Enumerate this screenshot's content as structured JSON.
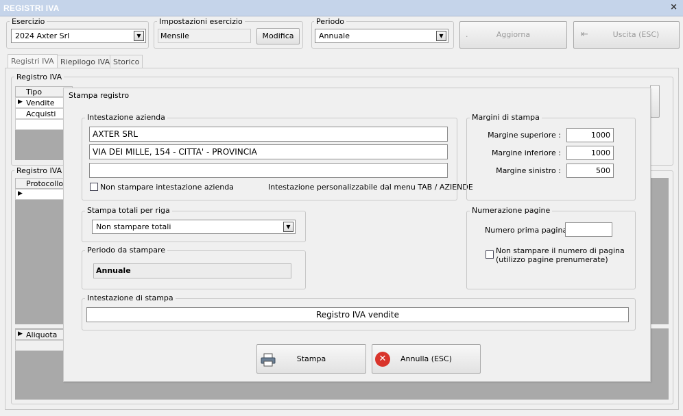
{
  "window": {
    "title": "REGISTRI IVA",
    "close": "×"
  },
  "esercizio": {
    "label": "Esercizio",
    "value": "2024 Axter Srl"
  },
  "impostazioni": {
    "label": "Impostazioni esercizio",
    "value": "Mensile",
    "button": "Modifica"
  },
  "periodo_top": {
    "label": "Periodo",
    "value": "Annuale"
  },
  "toolbar": {
    "aggiorna": "Aggiorna",
    "uscita": "Uscita (ESC)"
  },
  "tabs": [
    "Registri IVA",
    "Riepilogo IVA",
    "Storico"
  ],
  "registro_group": {
    "label": "Registro IVA",
    "col_tipo": "Tipo",
    "rows": [
      "Vendite",
      "Acquisti"
    ]
  },
  "registro_v": {
    "label": "Registro IVA v",
    "col": "Protocollo"
  },
  "aliquota": {
    "col": "Aliquota"
  },
  "dialog": {
    "title": "Stampa registro",
    "intestazione": {
      "label": "Intestazione azienda",
      "line1": "AXTER SRL",
      "line2": "VIA DEI MILLE, 154 - CITTA' - PROVINCIA",
      "line3": "",
      "no_stampa": "Non stampare intestazione azienda",
      "note": "Intestazione personalizzabile dal menu TAB / AZIENDE"
    },
    "margini": {
      "label": "Margini di stampa",
      "superiore_label": "Margine superiore :",
      "superiore": "1000",
      "inferiore_label": "Margine inferiore :",
      "inferiore": "1000",
      "sinistro_label": "Margine sinistro :",
      "sinistro": "500"
    },
    "totali": {
      "label": "Stampa totali per riga",
      "value": "Non stampare totali"
    },
    "numerazione": {
      "label": "Numerazione pagine",
      "prima_label": "Numero prima pagina :",
      "prima": "",
      "no_num_1": "Non stampare il numero di pagina",
      "no_num_2": "(utilizzo pagine prenumerate)"
    },
    "periodo": {
      "label": "Periodo da stampare",
      "value": "Annuale"
    },
    "intestazione_stampa": {
      "label": "Intestazione di stampa",
      "value": "Registro IVA vendite"
    },
    "stampa_button": "Stampa",
    "annulla_button": "Annulla (ESC)"
  },
  "colors": {
    "titlebar": "#c5d4ea",
    "grid_grey": "#a9a9a9",
    "cancel_red": "#d9342b"
  }
}
